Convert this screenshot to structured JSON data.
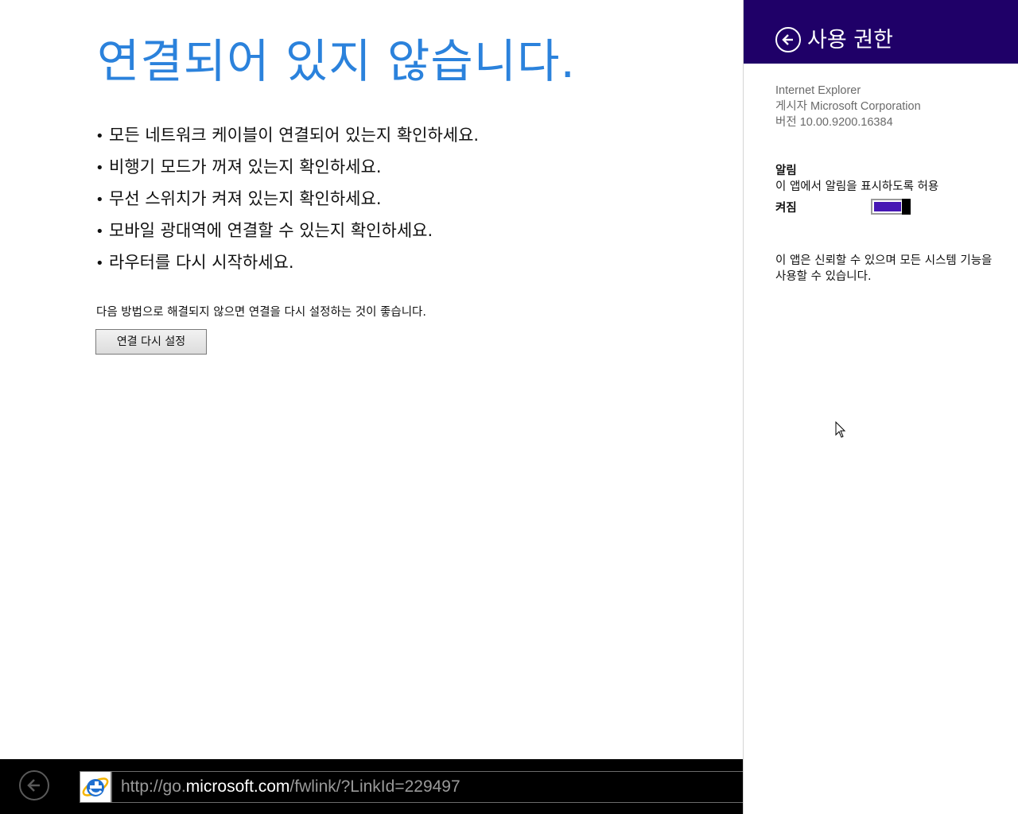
{
  "main": {
    "title": "연결되어 있지 않습니다.",
    "tips": [
      "모든 네트워크 케이블이 연결되어 있는지 확인하세요.",
      "비행기 모드가 꺼져 있는지 확인하세요.",
      "무선 스위치가 켜져 있는지 확인하세요.",
      "모바일 광대역에 연결할 수 있는지 확인하세요.",
      "라우터를 다시 시작하세요."
    ],
    "bullet": "•",
    "hint": "다음 방법으로 해결되지 않으면 연결을 다시 설정하는 것이 좋습니다.",
    "reset_button": "연결 다시 설정"
  },
  "address_bar": {
    "url_prefix": "http://go.",
    "url_domain": "microsoft.com",
    "url_suffix": "/fwlink/?LinkId=229497",
    "icons": {
      "back": "back-arrow-icon",
      "browser": "internet-explorer-icon"
    }
  },
  "permissions_pane": {
    "title": "사용 권한",
    "app_name": "Internet Explorer",
    "publisher": "게시자 Microsoft Corporation",
    "version": "버전 10.00.9200.16384",
    "notifications": {
      "label": "알림",
      "description": "이 앱에서 알림을 표시하도록 허용",
      "state_label": "켜짐",
      "enabled": true
    },
    "trust_note": "이 앱은 신뢰할 수 있으며 모든 시스템 기능을 사용할 수 있습니다."
  },
  "colors": {
    "title_blue": "#2b82dc",
    "pane_header": "#1f0068",
    "toggle_on": "#4617b4",
    "appbar": "#000000"
  }
}
